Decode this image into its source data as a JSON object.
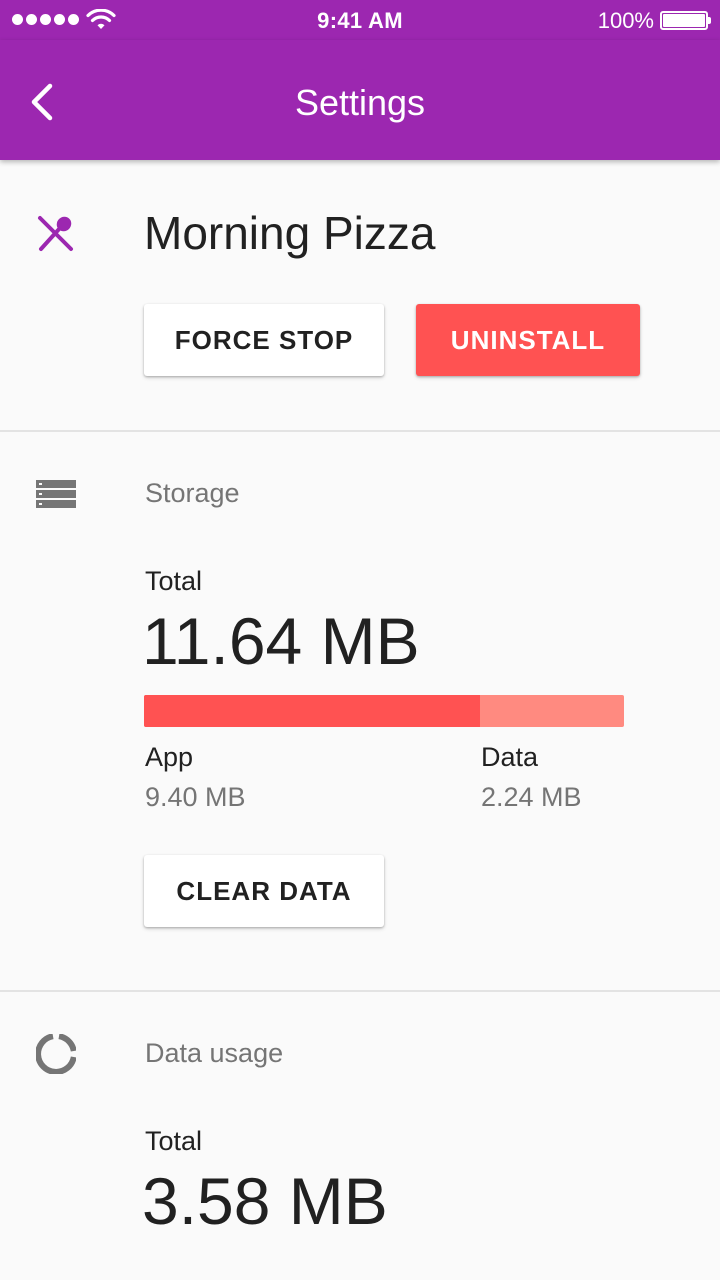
{
  "status_bar": {
    "time": "9:41 AM",
    "battery_percent": "100%",
    "signal_icon": "signal-dots-icon",
    "wifi_icon": "wifi-icon",
    "battery_icon": "battery-icon"
  },
  "app_bar": {
    "title": "Settings",
    "back_icon": "chevron-left-icon",
    "color": "#9c27b0"
  },
  "app_info": {
    "icon": "fork-spoon-icon",
    "name": "Morning Pizza",
    "force_stop_label": "FORCE STOP",
    "uninstall_label": "UNINSTALL",
    "uninstall_color": "#ff5252"
  },
  "storage": {
    "icon": "storage-icon",
    "title": "Storage",
    "total_label": "Total",
    "total_value": "11.64 MB",
    "app_label": "App",
    "app_value": "9.40 MB",
    "data_label": "Data",
    "data_value": "2.24 MB",
    "app_fraction": 0.7,
    "clear_data_label": "CLEAR DATA"
  },
  "data_usage": {
    "icon": "data-usage-icon",
    "title": "Data usage",
    "total_label": "Total",
    "total_value": "3.58 MB"
  }
}
